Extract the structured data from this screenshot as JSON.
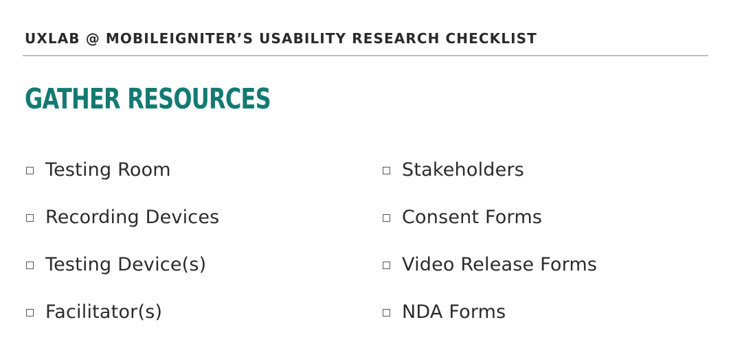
{
  "header": {
    "title": "UXLAB @ MOBILEIGNITER’S USABILITY RESEARCH CHECKLIST"
  },
  "section": {
    "title": "GATHER RESOURCES"
  },
  "checklist": {
    "left": [
      {
        "label": "Testing Room",
        "checked": false
      },
      {
        "label": "Recording Devices",
        "checked": false
      },
      {
        "label": "Testing Device(s)",
        "checked": false
      },
      {
        "label": "Facilitator(s)",
        "checked": false
      }
    ],
    "right": [
      {
        "label": "Stakeholders",
        "checked": false
      },
      {
        "label": "Consent Forms",
        "checked": false
      },
      {
        "label": "Video Release Forms",
        "checked": false
      },
      {
        "label": "NDA Forms",
        "checked": false
      }
    ]
  },
  "colors": {
    "accent": "#137a72",
    "text": "#2b2b2b",
    "rule": "#bdbdbd"
  }
}
